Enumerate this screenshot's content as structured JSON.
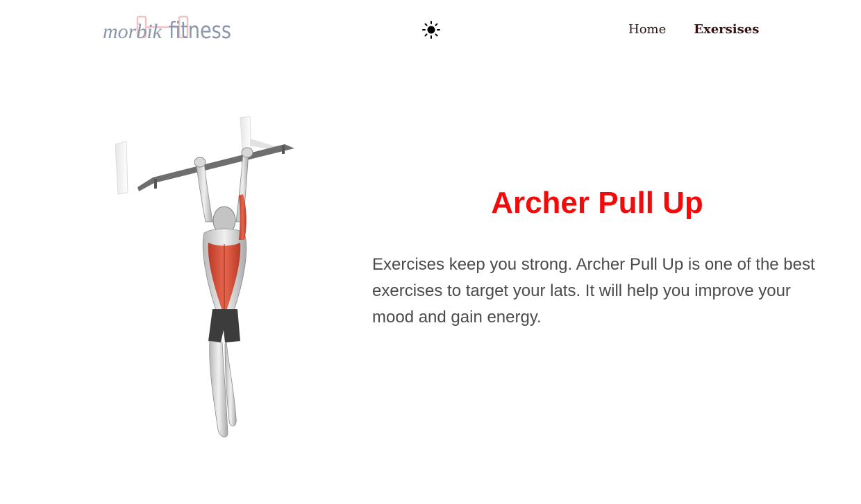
{
  "header": {
    "logo": {
      "text_part1": "morbik",
      "text_part2": "fitness",
      "colors": {
        "text": "#8a96ab",
        "mark": "#f2c2c2"
      }
    },
    "theme_toggle": {
      "icon": "sun-icon"
    },
    "nav": [
      {
        "label": "Home",
        "active": false
      },
      {
        "label": "Exersises",
        "active": true
      }
    ]
  },
  "exercise": {
    "title": "Archer Pull Up",
    "description": "Exercises keep you strong. Archer Pull Up is one of the best exercises to target your lats. It will help you improve your mood and gain energy.",
    "image": "archer-pull-up-illustration"
  },
  "colors": {
    "title": "#f20b0b",
    "body_text": "#4a4a4a",
    "nav_text": "#2d1414",
    "muscle_highlight": "#d9503a",
    "background": "#ffffff"
  }
}
